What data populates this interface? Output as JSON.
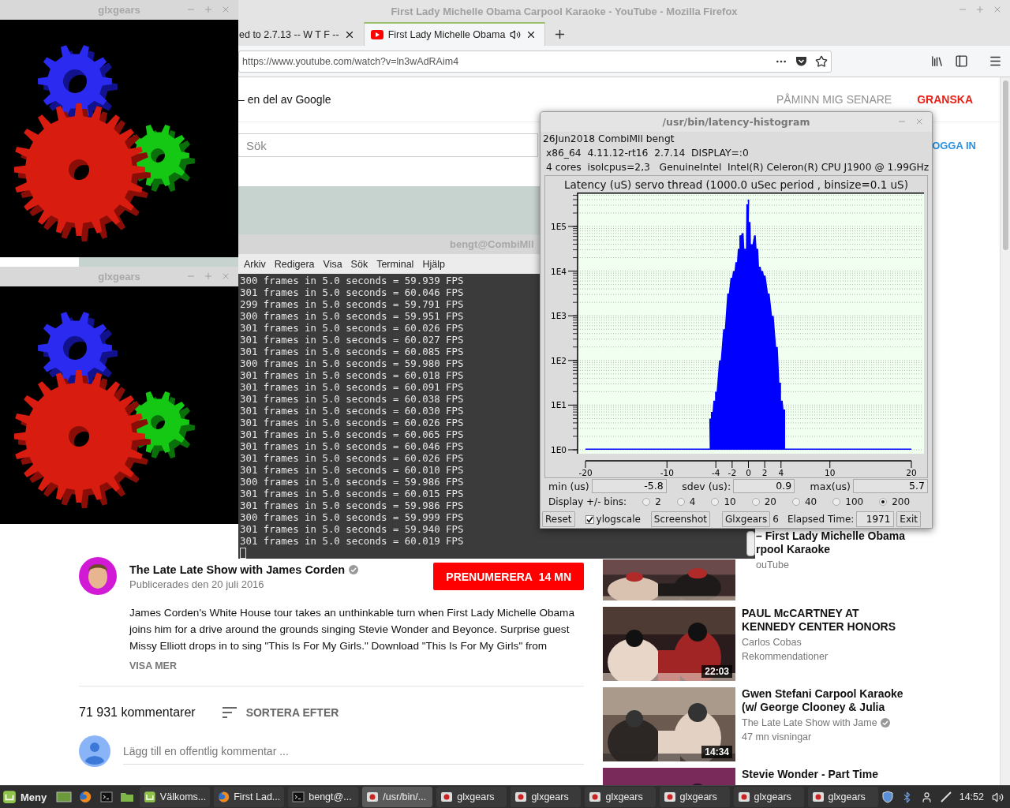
{
  "browser": {
    "title": "First Lady Michelle Obama Carpool Karaoke - YouTube - Mozilla Firefox",
    "tabs": [
      {
        "label": "ed to 2.7.13 -- W T F --",
        "selected": false,
        "audio": false
      },
      {
        "label": "First Lady Michelle Obama",
        "selected": true,
        "audio": true
      }
    ],
    "url": "https://www.youtube.com/watch?v=ln3wAdRAim4",
    "notice": {
      "text": "– en del av Google",
      "later": "PÅMINN MIG SENARE",
      "review": "GRANSKA"
    },
    "search": {
      "placeholder": "Sök"
    },
    "login": "OGGA IN",
    "channel": {
      "name": "The Late Late Show with James Corden",
      "verified": true,
      "published": "Publicerades den 20 juli 2016",
      "subscribe": "PRENUMERERA",
      "subscribers": "14 MN"
    },
    "description": "James Corden's White House tour takes an unthinkable turn when First Lady Michelle Obama joins him for a drive around the grounds singing Stevie Wonder and Beyonce. Surprise guest Missy Elliott drops in to sing \"This Is For My Girls.\"  Download \"This Is For My Girls\" from",
    "show_more": "VISA MER",
    "comments": {
      "count": "71 931 kommentarer",
      "sort": "SORTERA EFTER",
      "placeholder": "Lägg till en offentlig kommentar ..."
    },
    "recommendations": [
      {
        "title_lines": [
          "– First Lady Michelle Obama",
          "rpool Karaoke"
        ],
        "channel": "ouTube",
        "verified": false
      },
      {
        "title_lines": [
          "PAUL McCARTNEY AT",
          "KENNEDY CENTER HONORS"
        ],
        "channel": "Carlos Cobas",
        "verified": false,
        "meta": "Rekommendationer",
        "duration": "22:03"
      },
      {
        "title_lines": [
          "Gwen Stefani Carpool Karaoke",
          "(w/ George Clooney & Julia"
        ],
        "channel": "The Late Late Show with Jame",
        "verified": true,
        "meta": "47 mn visningar",
        "duration": "14:34"
      },
      {
        "title_lines": [
          "Stevie Wonder - Part Time"
        ],
        "verified": false
      }
    ]
  },
  "terminal": {
    "title": "bengt@CombiMll",
    "menu": [
      "Arkiv",
      "Redigera",
      "Visa",
      "Sök",
      "Terminal",
      "Hjälp"
    ],
    "lines": [
      "300 frames in 5.0 seconds = 59.939 FPS",
      "301 frames in 5.0 seconds = 60.046 FPS",
      "299 frames in 5.0 seconds = 59.791 FPS",
      "300 frames in 5.0 seconds = 59.951 FPS",
      "301 frames in 5.0 seconds = 60.026 FPS",
      "301 frames in 5.0 seconds = 60.027 FPS",
      "301 frames in 5.0 seconds = 60.085 FPS",
      "300 frames in 5.0 seconds = 59.980 FPS",
      "301 frames in 5.0 seconds = 60.018 FPS",
      "301 frames in 5.0 seconds = 60.091 FPS",
      "301 frames in 5.0 seconds = 60.038 FPS",
      "301 frames in 5.0 seconds = 60.030 FPS",
      "301 frames in 5.0 seconds = 60.026 FPS",
      "301 frames in 5.0 seconds = 60.065 FPS",
      "301 frames in 5.0 seconds = 60.046 FPS",
      "301 frames in 5.0 seconds = 60.026 FPS",
      "301 frames in 5.0 seconds = 60.010 FPS",
      "300 frames in 5.0 seconds = 59.986 FPS",
      "301 frames in 5.0 seconds = 60.015 FPS",
      "301 frames in 5.0 seconds = 59.986 FPS",
      "300 frames in 5.0 seconds = 59.999 FPS",
      "301 frames in 5.0 seconds = 59.940 FPS",
      "301 frames in 5.0 seconds = 60.019 FPS"
    ]
  },
  "gears_windows": [
    {
      "title": "glxgears"
    },
    {
      "title": "glxgears"
    }
  ],
  "histogram": {
    "title": "/usr/bin/latency-histogram",
    "info": [
      "26Jun2018 CombiMll bengt",
      " x86_64  4.11.12-rt16  2.7.14  DISPLAY=:0",
      " 4 cores  isolcpus=2,3   GenuineIntel  Intel(R) Celeron(R) CPU J1900 @ 1.99GHz"
    ],
    "chart": {
      "title": "Latency (uS) servo thread (1000.0 uSec period , binsize=0.1 uS)",
      "x_tick_labels": [
        "-20",
        "-10",
        "-4",
        "-2",
        "0",
        "2",
        "4",
        "10",
        "20"
      ],
      "y_tick_labels": [
        "1E5",
        "1E4",
        "1E3",
        "1E2",
        "1E1",
        "1E0"
      ]
    },
    "stats": [
      {
        "label": "min (us)",
        "value": "-5.8"
      },
      {
        "label": "sdev (us):",
        "value": "0.9"
      },
      {
        "label": "max(us)",
        "value": "5.7"
      }
    ],
    "bins_label": "Display +/- bins:",
    "bins": [
      {
        "label": "2",
        "selected": false
      },
      {
        "label": "4",
        "selected": false
      },
      {
        "label": "10",
        "selected": false
      },
      {
        "label": "20",
        "selected": false
      },
      {
        "label": "40",
        "selected": false
      },
      {
        "label": "100",
        "selected": false
      },
      {
        "label": "200",
        "selected": true
      }
    ],
    "reset": "Reset",
    "ylogscale": {
      "label": "ylogscale",
      "checked": true
    },
    "screenshot": "Screenshot",
    "glxgears": "Glxgears",
    "glxgears_count": "6",
    "elapsed_label": "Elapsed Time:",
    "elapsed": "1971",
    "exit": "Exit"
  },
  "taskbar": {
    "menu": "Meny",
    "tasks": [
      {
        "label": "Välkoms...",
        "kind": "welcome",
        "selected": false
      },
      {
        "label": "First Lad...",
        "kind": "firefox",
        "selected": false
      },
      {
        "label": "bengt@...",
        "kind": "terminal",
        "selected": false
      },
      {
        "label": "/usr/bin/...",
        "kind": "app",
        "selected": true
      },
      {
        "label": "glxgears",
        "kind": "app",
        "selected": false
      },
      {
        "label": "glxgears",
        "kind": "app",
        "selected": false
      },
      {
        "label": "glxgears",
        "kind": "app",
        "selected": false
      },
      {
        "label": "glxgears",
        "kind": "app",
        "selected": false
      },
      {
        "label": "glxgears",
        "kind": "app",
        "selected": false
      },
      {
        "label": "glxgears",
        "kind": "app",
        "selected": false
      }
    ],
    "clock": "14:52"
  }
}
